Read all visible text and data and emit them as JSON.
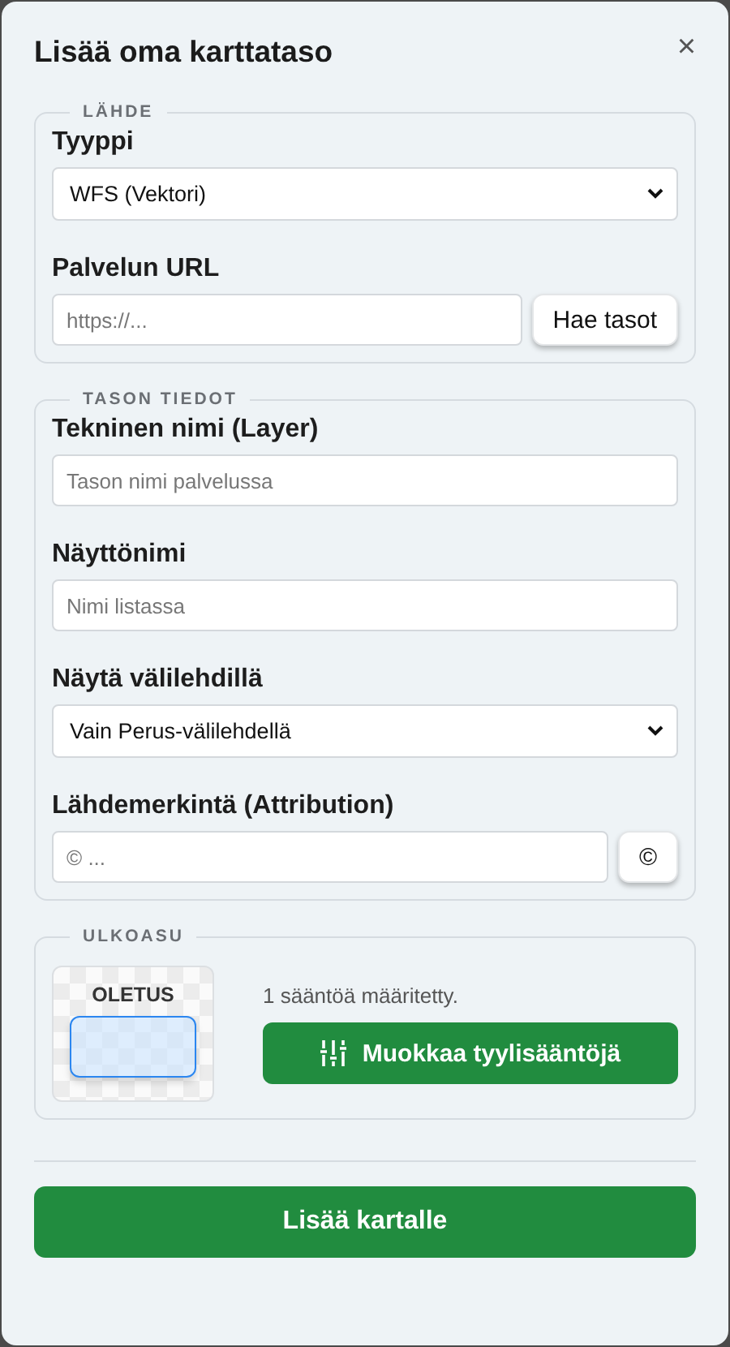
{
  "dialog": {
    "title": "Lisää oma karttataso",
    "close_icon": "×"
  },
  "sections": [
    {
      "legend": "LÄHDE",
      "fields": [
        {
          "kind": "select",
          "label": "Tyyppi",
          "value": "WFS (Vektori)"
        },
        {
          "kind": "input_button",
          "label": "Palvelun URL",
          "placeholder": "https://...",
          "button": "Hae tasot"
        }
      ]
    },
    {
      "legend": "TASON TIEDOT",
      "fields": [
        {
          "kind": "input",
          "label": "Tekninen nimi (Layer)",
          "placeholder": "Tason nimi palvelussa"
        },
        {
          "kind": "input",
          "label": "Näyttönimi",
          "placeholder": "Nimi listassa"
        },
        {
          "kind": "select",
          "label": "Näytä välilehdillä",
          "value": "Vain Perus-välilehdellä"
        },
        {
          "kind": "input_button",
          "label": "Lähdemerkintä (Attribution)",
          "placeholder": "© ...",
          "button": "©"
        }
      ]
    },
    {
      "legend": "ULKOASU",
      "style": {
        "preview_label": "OLETUS",
        "rules_text": "1 sääntöä määritetty.",
        "edit_button": "Muokkaa tyylisääntöjä"
      }
    }
  ],
  "submit_button": "Lisää kartalle"
}
